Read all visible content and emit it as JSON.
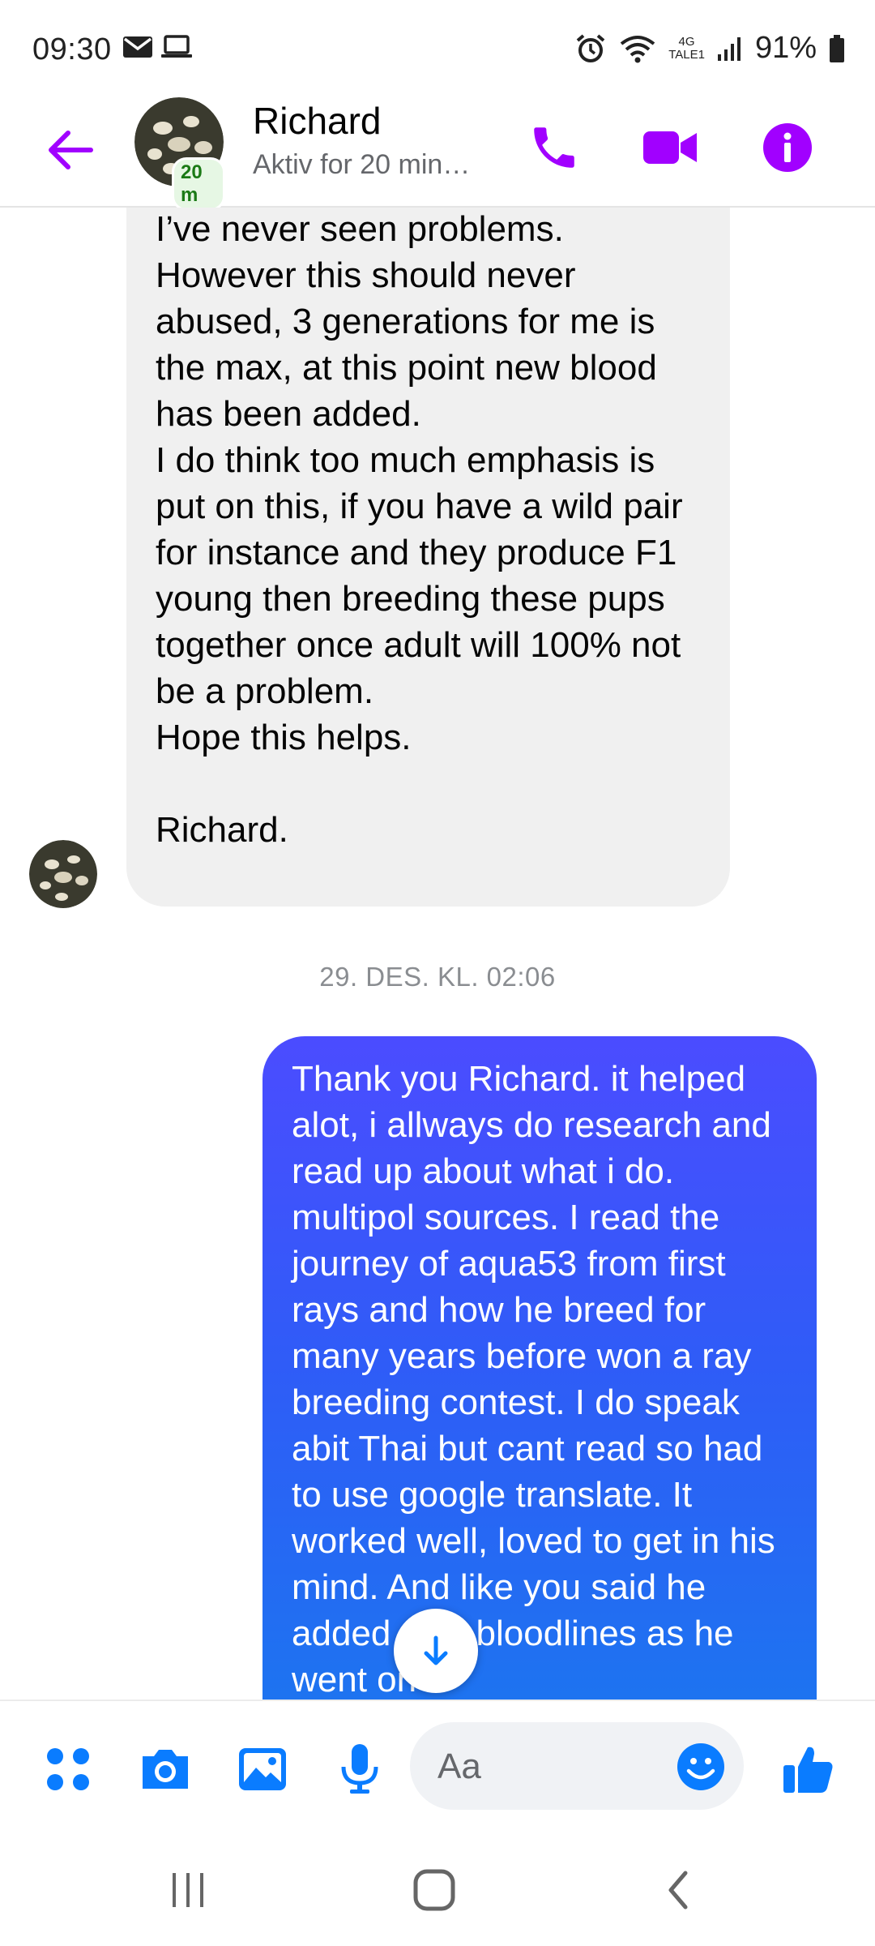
{
  "status_bar": {
    "time": "09:30",
    "network_label_top": "4G",
    "network_label_bottom": "TALE1",
    "battery": "91%",
    "icons": [
      "mail-icon",
      "laptop-icon",
      "alarm-icon",
      "wifi-icon",
      "signal-icon",
      "battery-icon"
    ]
  },
  "header": {
    "name": "Richard",
    "status": "Aktiv for 20 min…",
    "active_badge": "20 m",
    "accent_color": "#a100ff"
  },
  "messages": {
    "incoming": {
      "text": "I’ve never seen problems.\nHowever this should never abused, 3 generations for me is the max, at this point new blood has been added.\nI do think too much emphasis is put on this, if you have a wild pair for instance and they produce F1 young then breeding these pups together once adult will 100% not be a problem.\nHope this helps.\n\nRichard."
    },
    "timestamp": "29. DES. KL. 02:06",
    "outgoing": {
      "text": "Thank you Richard. it helped alot, i allways do research and read up about what i do. multipol sources. I read the journey of aqua53 from first rays and how he breed for many years before won a ray breeding contest. I do speak abit Thai but cant read so had to use google translate. It worked well, loved to get in his mind. And like you said he added new bloodlines as he went on"
    }
  },
  "composer": {
    "placeholder": "Aa",
    "accent_color": "#0a7cff"
  }
}
